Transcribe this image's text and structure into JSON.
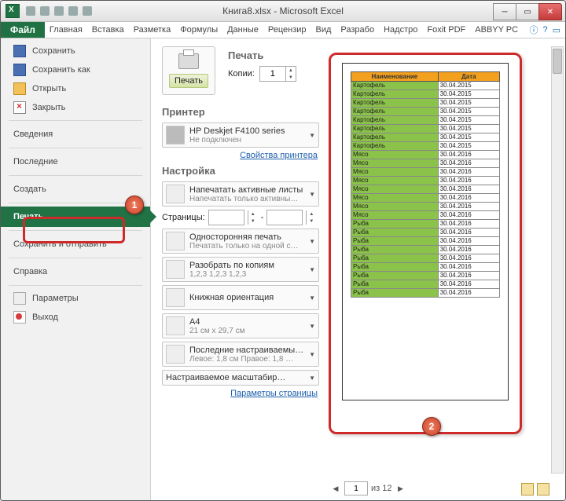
{
  "title": "Книга8.xlsx - Microsoft Excel",
  "ribbon": {
    "file": "Файл",
    "tabs": [
      "Главная",
      "Вставка",
      "Разметка",
      "Формулы",
      "Данные",
      "Рецензир",
      "Вид",
      "Разрабо",
      "Надстро",
      "Foxit PDF",
      "ABBYY PC"
    ]
  },
  "side": {
    "save": "Сохранить",
    "saveas": "Сохранить как",
    "open": "Открыть",
    "closef": "Закрыть",
    "info": "Сведения",
    "recent": "Последние",
    "new": "Создать",
    "print": "Печать",
    "share": "Сохранить и отправить",
    "help": "Справка",
    "options": "Параметры",
    "exit": "Выход"
  },
  "mid": {
    "title": "Печать",
    "print_btn": "Печать",
    "copies_lbl": "Копии:",
    "copies_val": "1",
    "printer_h": "Принтер",
    "printer_name": "HP Deskjet F4100 series",
    "printer_state": "Не подключен",
    "printer_props": "Свойства принтера",
    "setup_h": "Настройка",
    "what_t": "Напечатать активные листы",
    "what_s": "Напечатать только активны…",
    "pages_lbl": "Страницы:",
    "dash": "-",
    "side_t": "Односторонняя печать",
    "side_s": "Печатать только на одной с…",
    "coll_t": "Разобрать по копиям",
    "coll_s": "1,2,3   1,2,3   1,2,3",
    "orient": "Книжная ориентация",
    "paper_t": "A4",
    "paper_s": "21 см x 29,7 см",
    "marg_t": "Последние настраиваемые …",
    "marg_s": "Левое: 1,8 см   Правое: 1,8 …",
    "scale": "Настраиваемое масштабир…",
    "page_params": "Параметры страницы"
  },
  "preview": {
    "hdr_name": "Наименование",
    "hdr_date": "Дата",
    "rows": [
      [
        "Картофель",
        "30.04.2015"
      ],
      [
        "Картофель",
        "30.04.2015"
      ],
      [
        "Картофель",
        "30.04.2015"
      ],
      [
        "Картофель",
        "30.04.2015"
      ],
      [
        "Картофель",
        "30.04.2015"
      ],
      [
        "Картофель",
        "30.04.2015"
      ],
      [
        "Картофель",
        "30.04.2015"
      ],
      [
        "Картофель",
        "30.04.2015"
      ],
      [
        "Мясо",
        "30.04.2016"
      ],
      [
        "Мясо",
        "30.04.2016"
      ],
      [
        "Мясо",
        "30.04.2016"
      ],
      [
        "Мясо",
        "30.04.2016"
      ],
      [
        "Мясо",
        "30.04.2016"
      ],
      [
        "Мясо",
        "30.04.2016"
      ],
      [
        "Мясо",
        "30.04.2016"
      ],
      [
        "Мясо",
        "30.04.2016"
      ],
      [
        "Рыба",
        "30.04.2016"
      ],
      [
        "Рыба",
        "30.04.2016"
      ],
      [
        "Рыба",
        "30.04.2016"
      ],
      [
        "Рыба",
        "30.04.2016"
      ],
      [
        "Рыба",
        "30.04.2016"
      ],
      [
        "Рыба",
        "30.04.2016"
      ],
      [
        "Рыба",
        "30.04.2016"
      ],
      [
        "Рыба",
        "30.04.2016"
      ],
      [
        "Рыба",
        "30.04.2016"
      ]
    ],
    "page_cur": "1",
    "page_of": "из 12"
  },
  "callouts": {
    "c1": "1",
    "c2": "2"
  }
}
